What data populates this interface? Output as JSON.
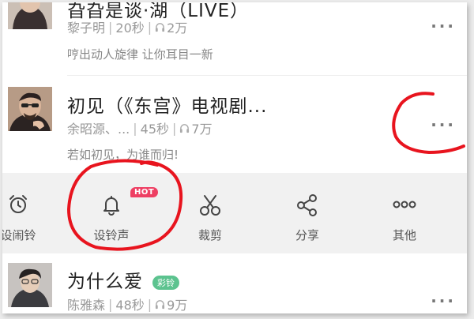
{
  "songs": [
    {
      "title": "旮旮是谈·湖（LIVE）",
      "artist": "黎子明",
      "duration": "20秒",
      "plays": "2万",
      "description": "哼出动人旋律 让你耳目一新",
      "more": "···"
    },
    {
      "title": "初见（《东宫》电视剧...",
      "artist": "余昭源、...",
      "duration": "45秒",
      "plays": "7万",
      "description": "若如初见，为谁而归!",
      "more": "···"
    },
    {
      "title": "为什么爱",
      "badge": "彩铃",
      "artist": "陈雅森",
      "duration": "48秒",
      "plays": "9万",
      "more": "···"
    }
  ],
  "actions": [
    {
      "label": "设闹铃",
      "icon": "alarm-clock-icon"
    },
    {
      "label": "设铃声",
      "icon": "bell-icon",
      "badge": "HOT"
    },
    {
      "label": "裁剪",
      "icon": "scissors-icon"
    },
    {
      "label": "分享",
      "icon": "share-icon"
    },
    {
      "label": "其他",
      "icon": "more-dots-icon"
    }
  ],
  "colors": {
    "annotation_red": "#e8141e",
    "hot_badge": "#ee3f63",
    "ringback_badge": "#5cc38f"
  }
}
